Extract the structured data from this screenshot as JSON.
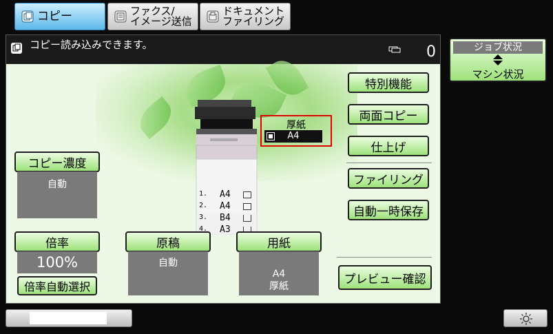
{
  "tabs": [
    {
      "label": "コピー",
      "active": true
    },
    {
      "label": "ファクス/\nイメージ送信",
      "active": false
    },
    {
      "label": "ドキュメント\nファイリング",
      "active": false
    }
  ],
  "status": {
    "message": "コピー読み込みできます。",
    "job_count": "0"
  },
  "functions": {
    "special": "特別機能",
    "duplex": "両面コピー",
    "finish": "仕上げ",
    "filing": "ファイリング",
    "auto_store": "自動一時保存",
    "preview": "プレビュー確認"
  },
  "exposure": {
    "label": "コピー濃度",
    "value": "自動"
  },
  "ratio": {
    "label": "倍率",
    "value": "100%",
    "auto_label": "倍率自動選択"
  },
  "original": {
    "label": "原稿",
    "value": "自動"
  },
  "paper": {
    "label": "用紙",
    "size": "A4",
    "type": "厚紙"
  },
  "bypass": {
    "type": "厚紙",
    "size": "A4"
  },
  "trays": [
    {
      "num": "1.",
      "size": "A4"
    },
    {
      "num": "2.",
      "size": "A4"
    },
    {
      "num": "3.",
      "size": "B4"
    },
    {
      "num": "4.",
      "size": "A3"
    }
  ],
  "job_status": {
    "top": "ジョブ状況",
    "bottom": "マシン状況"
  },
  "colors": {
    "accent_green": "#9ee27b",
    "tab_active": "#5cb8ea",
    "highlight": "#e00000"
  }
}
